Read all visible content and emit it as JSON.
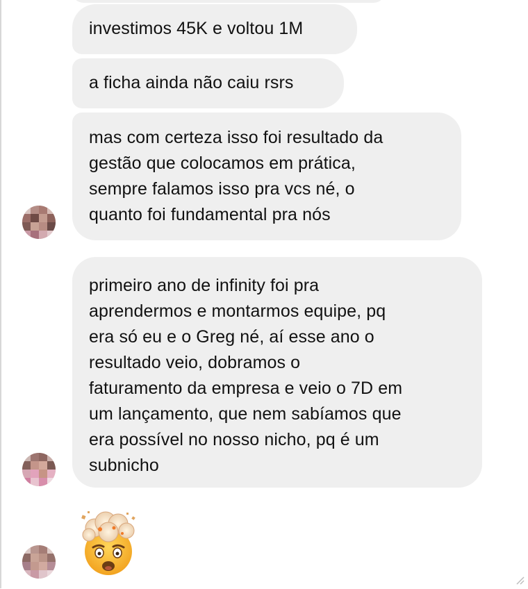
{
  "messages": [
    {
      "text": "investimos 45K e voltou 1M"
    },
    {
      "text": "a ficha ainda não caiu rsrs"
    },
    {
      "text": "mas com certeza isso foi resultado da\ngestão que colocamos em prática,\nsempre falamos isso pra vcs né, o\nquanto foi fundamental pra nós"
    },
    {
      "text": "primeiro ano de infinity foi pra\naprendermos e montarmos equipe, pq\nera só eu e o Greg né, aí esse ano o\nresultado veio, dobramos o\nfaturamento da empresa e veio o 7D em\num lançamento, que nem sabíamos que\nera possível no nosso nicho, pq é um\nsubnicho"
    }
  ],
  "reaction_emoji": "exploding-head-emoji",
  "colors": {
    "bubble_background": "#efefef",
    "text": "#111111",
    "page_background": "#ffffff"
  }
}
